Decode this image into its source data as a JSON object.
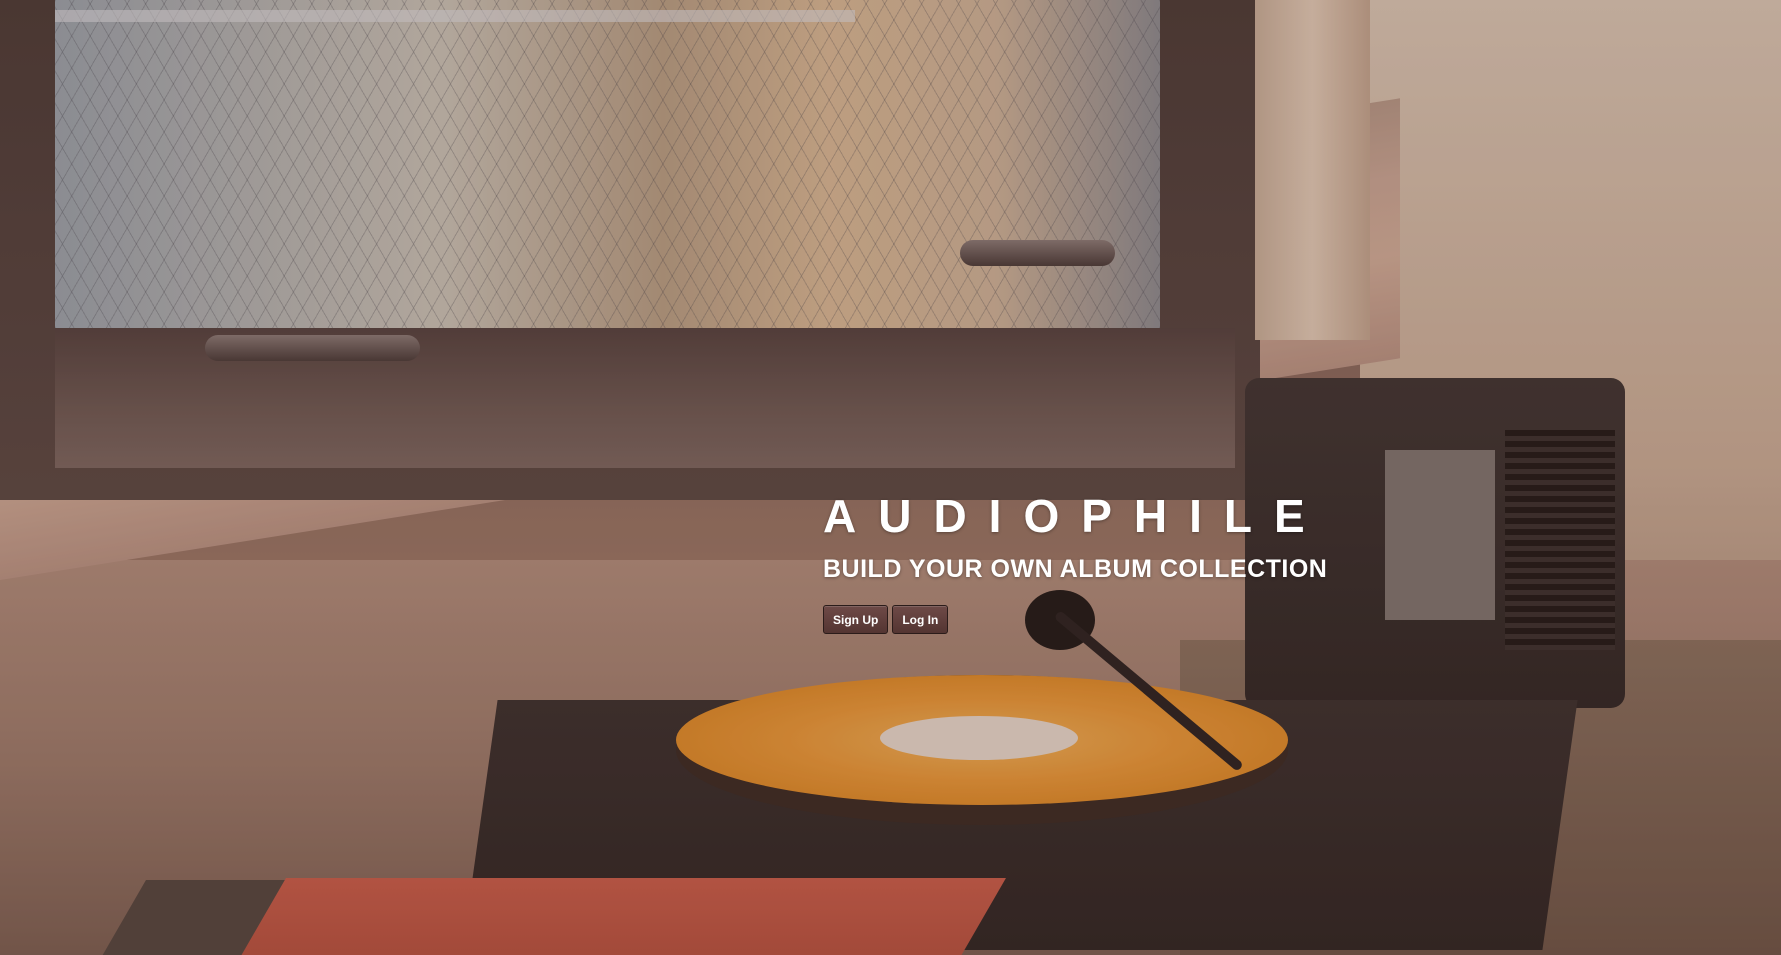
{
  "hero": {
    "title": "AUDIOPHILE",
    "tagline": "BUILD YOUR OWN ALBUM COLLECTION"
  },
  "actions": {
    "signup_label": "Sign Up",
    "login_label": "Log In"
  },
  "colors": {
    "button_bg": "#5e3f3c",
    "text": "#ffffff"
  }
}
